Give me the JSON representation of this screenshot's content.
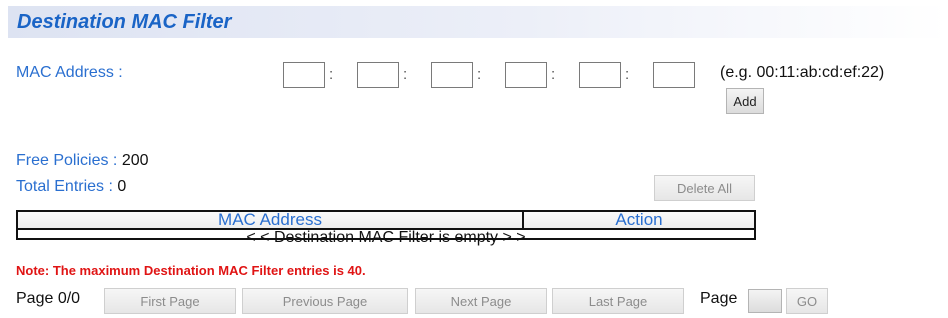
{
  "header": {
    "title": "Destination MAC Filter"
  },
  "form": {
    "mac_label": "MAC Address :",
    "separator": ":",
    "mac_fields": [
      "",
      "",
      "",
      "",
      "",
      ""
    ],
    "example": "(e.g. 00:11:ab:cd:ef:22)",
    "add_label": "Add"
  },
  "stats": {
    "free_label": "Free Policies :",
    "free_value": "200",
    "total_label": "Total Entries :",
    "total_value": "0",
    "delete_all_label": "Delete All"
  },
  "table": {
    "columns": [
      "MAC Address",
      "Action"
    ],
    "empty_message": "< < Destination MAC Filter is empty > >"
  },
  "note": "Note: The maximum Destination MAC Filter entries is 40.",
  "pagination": {
    "page_info": "Page 0/0",
    "first_label": "First Page",
    "previous_label": "Previous Page",
    "next_label": "Next Page",
    "last_label": "Last Page",
    "page_label": "Page",
    "page_value": "",
    "go_label": "GO"
  }
}
